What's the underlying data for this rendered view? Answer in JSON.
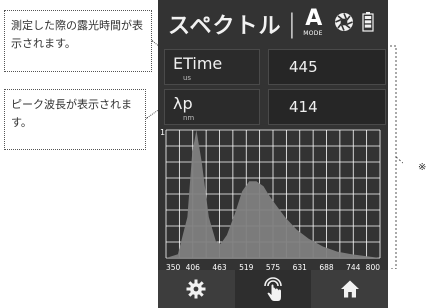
{
  "callouts": {
    "exposure_note": "測定した際の露光時間が表示されます。",
    "peak_note": "ピーク波長が表示されます。"
  },
  "header": {
    "title": "スペクトル",
    "mode_letter": "A",
    "mode_label": "MODE"
  },
  "metrics": [
    {
      "label": "ETime",
      "unit": "us",
      "value": "445"
    },
    {
      "label": "λp",
      "unit": "nm",
      "value": "414"
    }
  ],
  "chart_data": {
    "type": "area",
    "x_ticks": [
      "350",
      "406",
      "463",
      "519",
      "575",
      "631",
      "688",
      "744",
      "800"
    ],
    "y_max_label": "1",
    "xlim": [
      350,
      800
    ],
    "ylim": [
      0,
      1
    ],
    "grid": true,
    "series": [
      {
        "x": [
          350,
          375,
          395,
          405,
          414,
          425,
          440,
          455,
          465,
          478,
          495,
          510,
          525,
          540,
          555,
          565,
          580,
          600,
          625,
          650,
          680,
          710,
          740,
          770,
          800
        ],
        "y": [
          0.0,
          0.03,
          0.32,
          0.82,
          1.0,
          0.75,
          0.32,
          0.13,
          0.11,
          0.18,
          0.35,
          0.52,
          0.6,
          0.6,
          0.56,
          0.5,
          0.42,
          0.32,
          0.22,
          0.15,
          0.09,
          0.05,
          0.03,
          0.015,
          0.0
        ]
      }
    ],
    "fill_color": "#7f7f7f"
  },
  "nav": {
    "items": [
      {
        "icon": "gear-icon"
      },
      {
        "icon": "touch-hand-icon"
      },
      {
        "icon": "home-icon"
      }
    ]
  },
  "annotation_mark": "※",
  "colors": {
    "device_bg": "#333333",
    "grid": "#ffffff",
    "spectrum_fill": "#7f7f7f"
  }
}
